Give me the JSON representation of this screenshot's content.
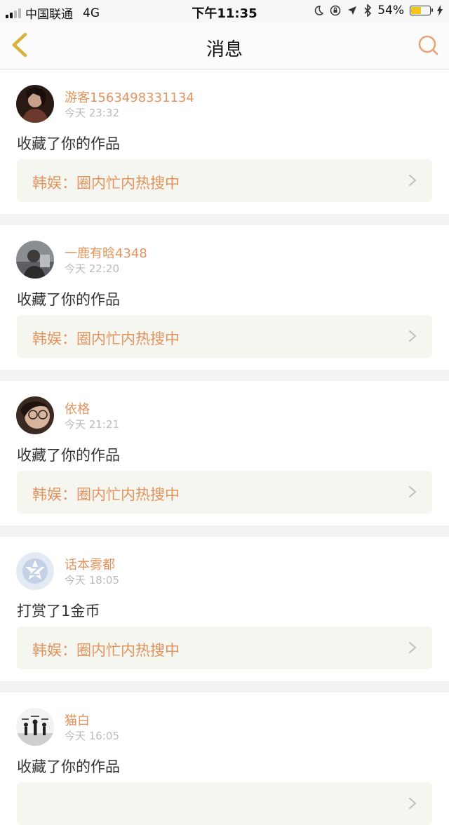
{
  "status": {
    "carrier": "中国联通",
    "network": "4G",
    "time": "下午11:35",
    "battery": "54%",
    "battery_level": 0.54
  },
  "header": {
    "title": "消息",
    "back_icon": "chevron-left-icon",
    "search_icon": "search-icon",
    "accent": "#e3935e"
  },
  "messages": [
    {
      "user": "游客1563498331134",
      "time": "今天 23:32",
      "action": "收藏了你的作品",
      "work": "韩娱：圈内忙内热搜中"
    },
    {
      "user": "一鹿有晗4348",
      "time": "今天 22:20",
      "action": "收藏了你的作品",
      "work": "韩娱：圈内忙内热搜中"
    },
    {
      "user": "依格",
      "time": "今天 21:21",
      "action": "收藏了你的作品",
      "work": "韩娱：圈内忙内热搜中"
    },
    {
      "user": "话本雾都",
      "time": "今天 18:05",
      "action": "打赏了1金币",
      "work": "韩娱：圈内忙内热搜中"
    },
    {
      "user": "猫白",
      "time": "今天 16:05",
      "action": "收藏了你的作品",
      "work": ""
    }
  ]
}
